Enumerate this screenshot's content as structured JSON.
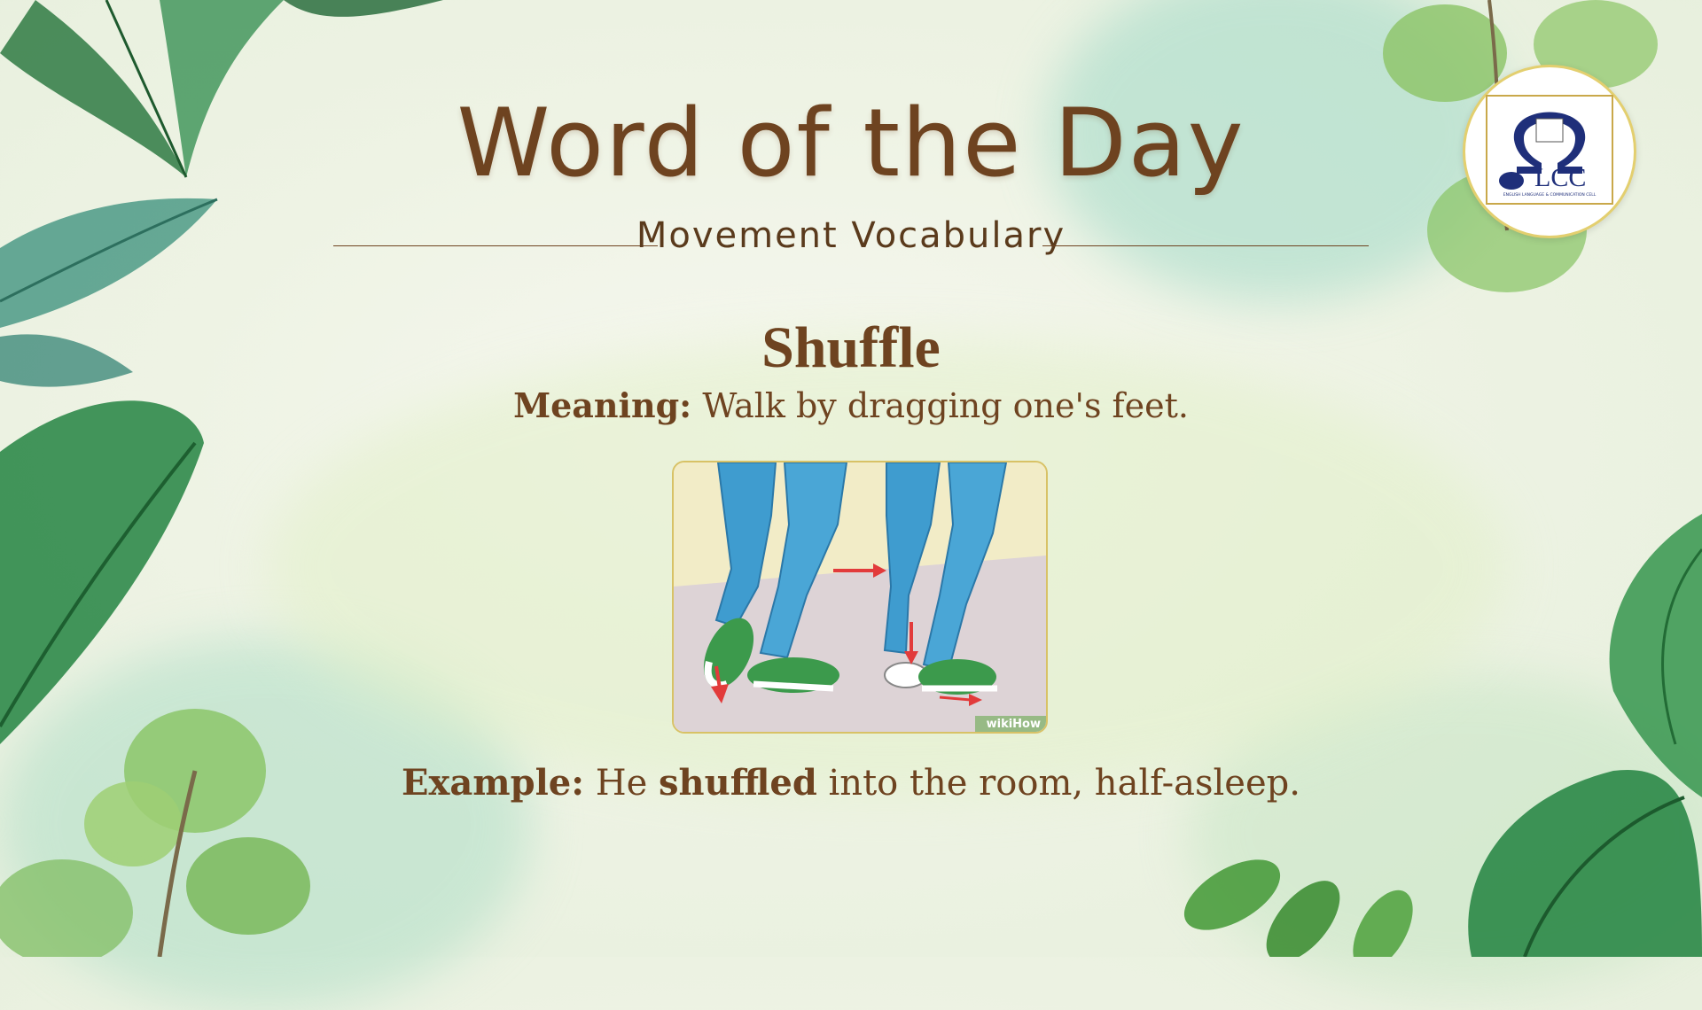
{
  "slide": {
    "title": "Word of the Day",
    "subtitle": "Movement Vocabulary",
    "word": "Shuffle",
    "meaning_label": "Meaning:",
    "meaning_text": "Walk by dragging one's feet.",
    "example_label": "Example:",
    "example_pre": "He",
    "example_bold": "shuffled",
    "example_post": "into the room, half-asleep."
  },
  "logo": {
    "text": "LCC",
    "caption": "ENGLISH LANGUAGE & COMMUNICATION CELL"
  },
  "illustration": {
    "watermark": "wikiHow"
  },
  "colors": {
    "text_brown": "#6e4320",
    "leaf_green": "#3f8f58",
    "jeans_blue": "#3f9ccf"
  }
}
